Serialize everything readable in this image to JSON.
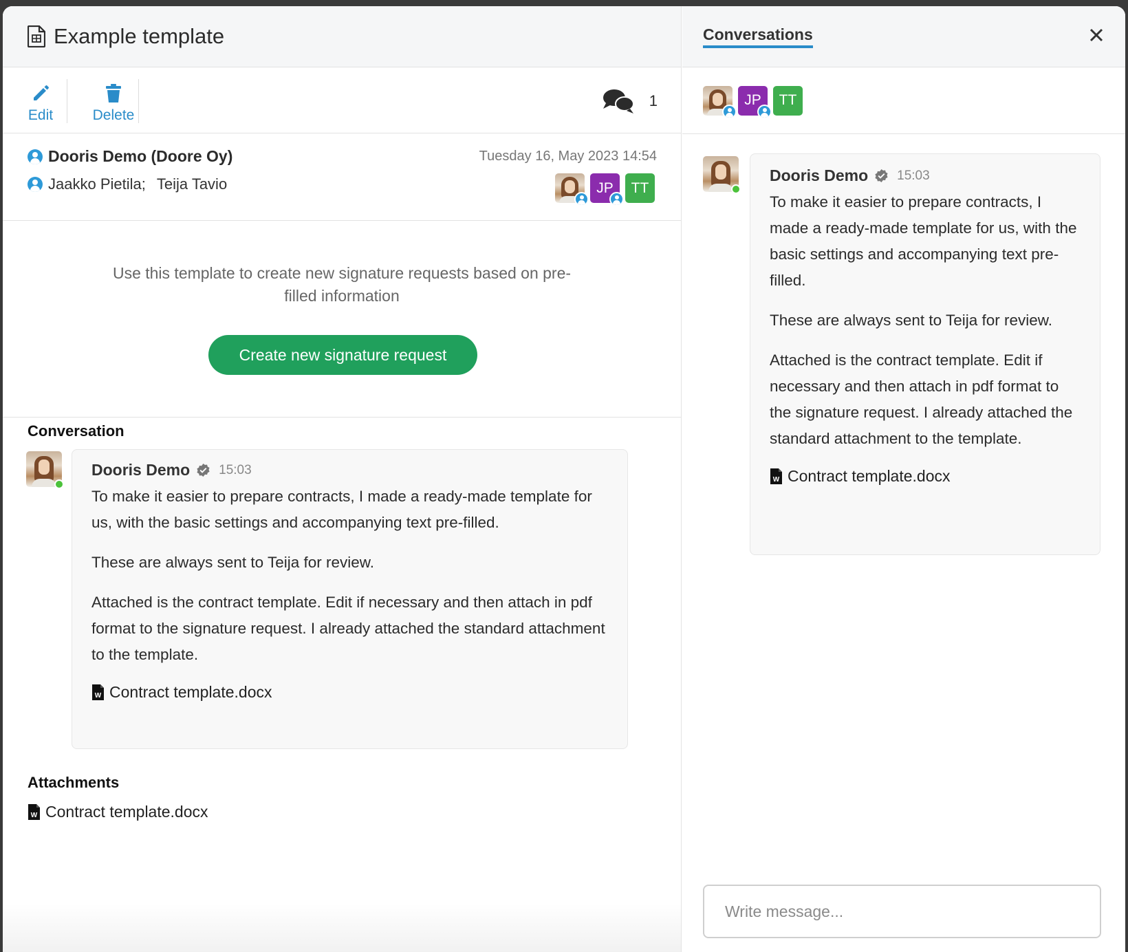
{
  "template": {
    "title": "Example template"
  },
  "toolbar": {
    "edit_label": "Edit",
    "delete_label": "Delete",
    "conversation_count": "1"
  },
  "meta": {
    "owner": "Dooris Demo (Doore Oy)",
    "recipient_1": "Jaakko Pietila;",
    "recipient_2": "Teija Tavio",
    "date": "Tuesday 16, May 2023 14:54"
  },
  "participants": [
    {
      "type": "photo",
      "initials": ""
    },
    {
      "type": "initials",
      "initials": "JP",
      "color": "#8b2cad"
    },
    {
      "type": "initials",
      "initials": "TT",
      "color": "#3fae4e"
    }
  ],
  "info": {
    "text": "Use this template to create new signature requests based on pre-filled information",
    "button_label": "Create new signature request"
  },
  "conversation": {
    "section_title": "Conversation",
    "message": {
      "author": "Dooris Demo",
      "time": "15:03",
      "paragraphs": [
        "To make it easier to prepare contracts, I made a ready-made template for us, with the basic settings and accompanying text pre-filled.",
        "These are always sent to Teija for review.",
        "Attached is the contract template. Edit if necessary and then attach in pdf format to the signature request. I already attached the standard attachment to the template."
      ],
      "attachment": "Contract template.docx"
    }
  },
  "attachments": {
    "section_title": "Attachments",
    "items": [
      "Contract template.docx"
    ]
  },
  "side_panel": {
    "tab_label": "Conversations",
    "compose_placeholder": "Write message..."
  },
  "colors": {
    "accent": "#2a8cc9",
    "primary_button": "#20a05c",
    "online": "#4cc23b"
  }
}
